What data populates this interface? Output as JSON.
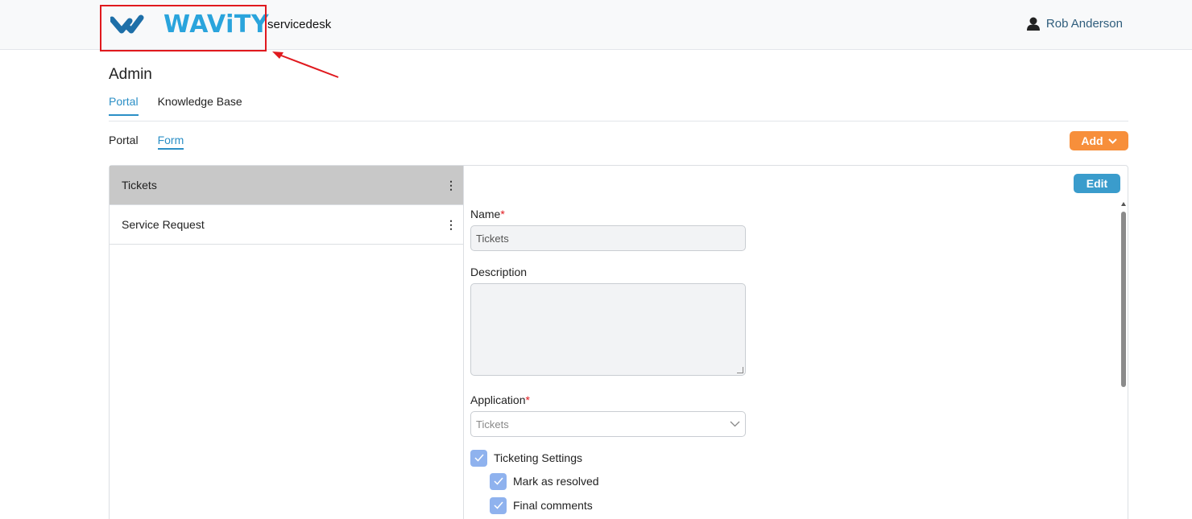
{
  "header": {
    "logo_text": "WAViTY",
    "product": "servicedesk",
    "user_name": "Rob Anderson"
  },
  "page": {
    "title": "Admin",
    "tabs": [
      {
        "label": "Portal",
        "active": true
      },
      {
        "label": "Knowledge Base",
        "active": false
      }
    ],
    "subtabs": [
      {
        "label": "Portal",
        "active": false
      },
      {
        "label": "Form",
        "active": true
      }
    ],
    "add_label": "Add"
  },
  "list": {
    "items": [
      {
        "label": "Tickets",
        "selected": true
      },
      {
        "label": "Service Request",
        "selected": false
      }
    ]
  },
  "detail": {
    "edit_label": "Edit",
    "name_label": "Name",
    "name_value": "Tickets",
    "required_mark": "*",
    "description_label": "Description",
    "description_value": "",
    "application_label": "Application",
    "application_value": "Tickets",
    "checkboxes": [
      {
        "label": "Ticketing Settings",
        "checked": true
      },
      {
        "label": "Mark as resolved",
        "checked": true
      },
      {
        "label": "Final comments",
        "checked": true
      }
    ]
  },
  "colors": {
    "brand": "#2aa4dc",
    "accent_orange": "#f78f3b",
    "edit_blue": "#3a9ccc",
    "highlight_red": "#e0191e"
  }
}
